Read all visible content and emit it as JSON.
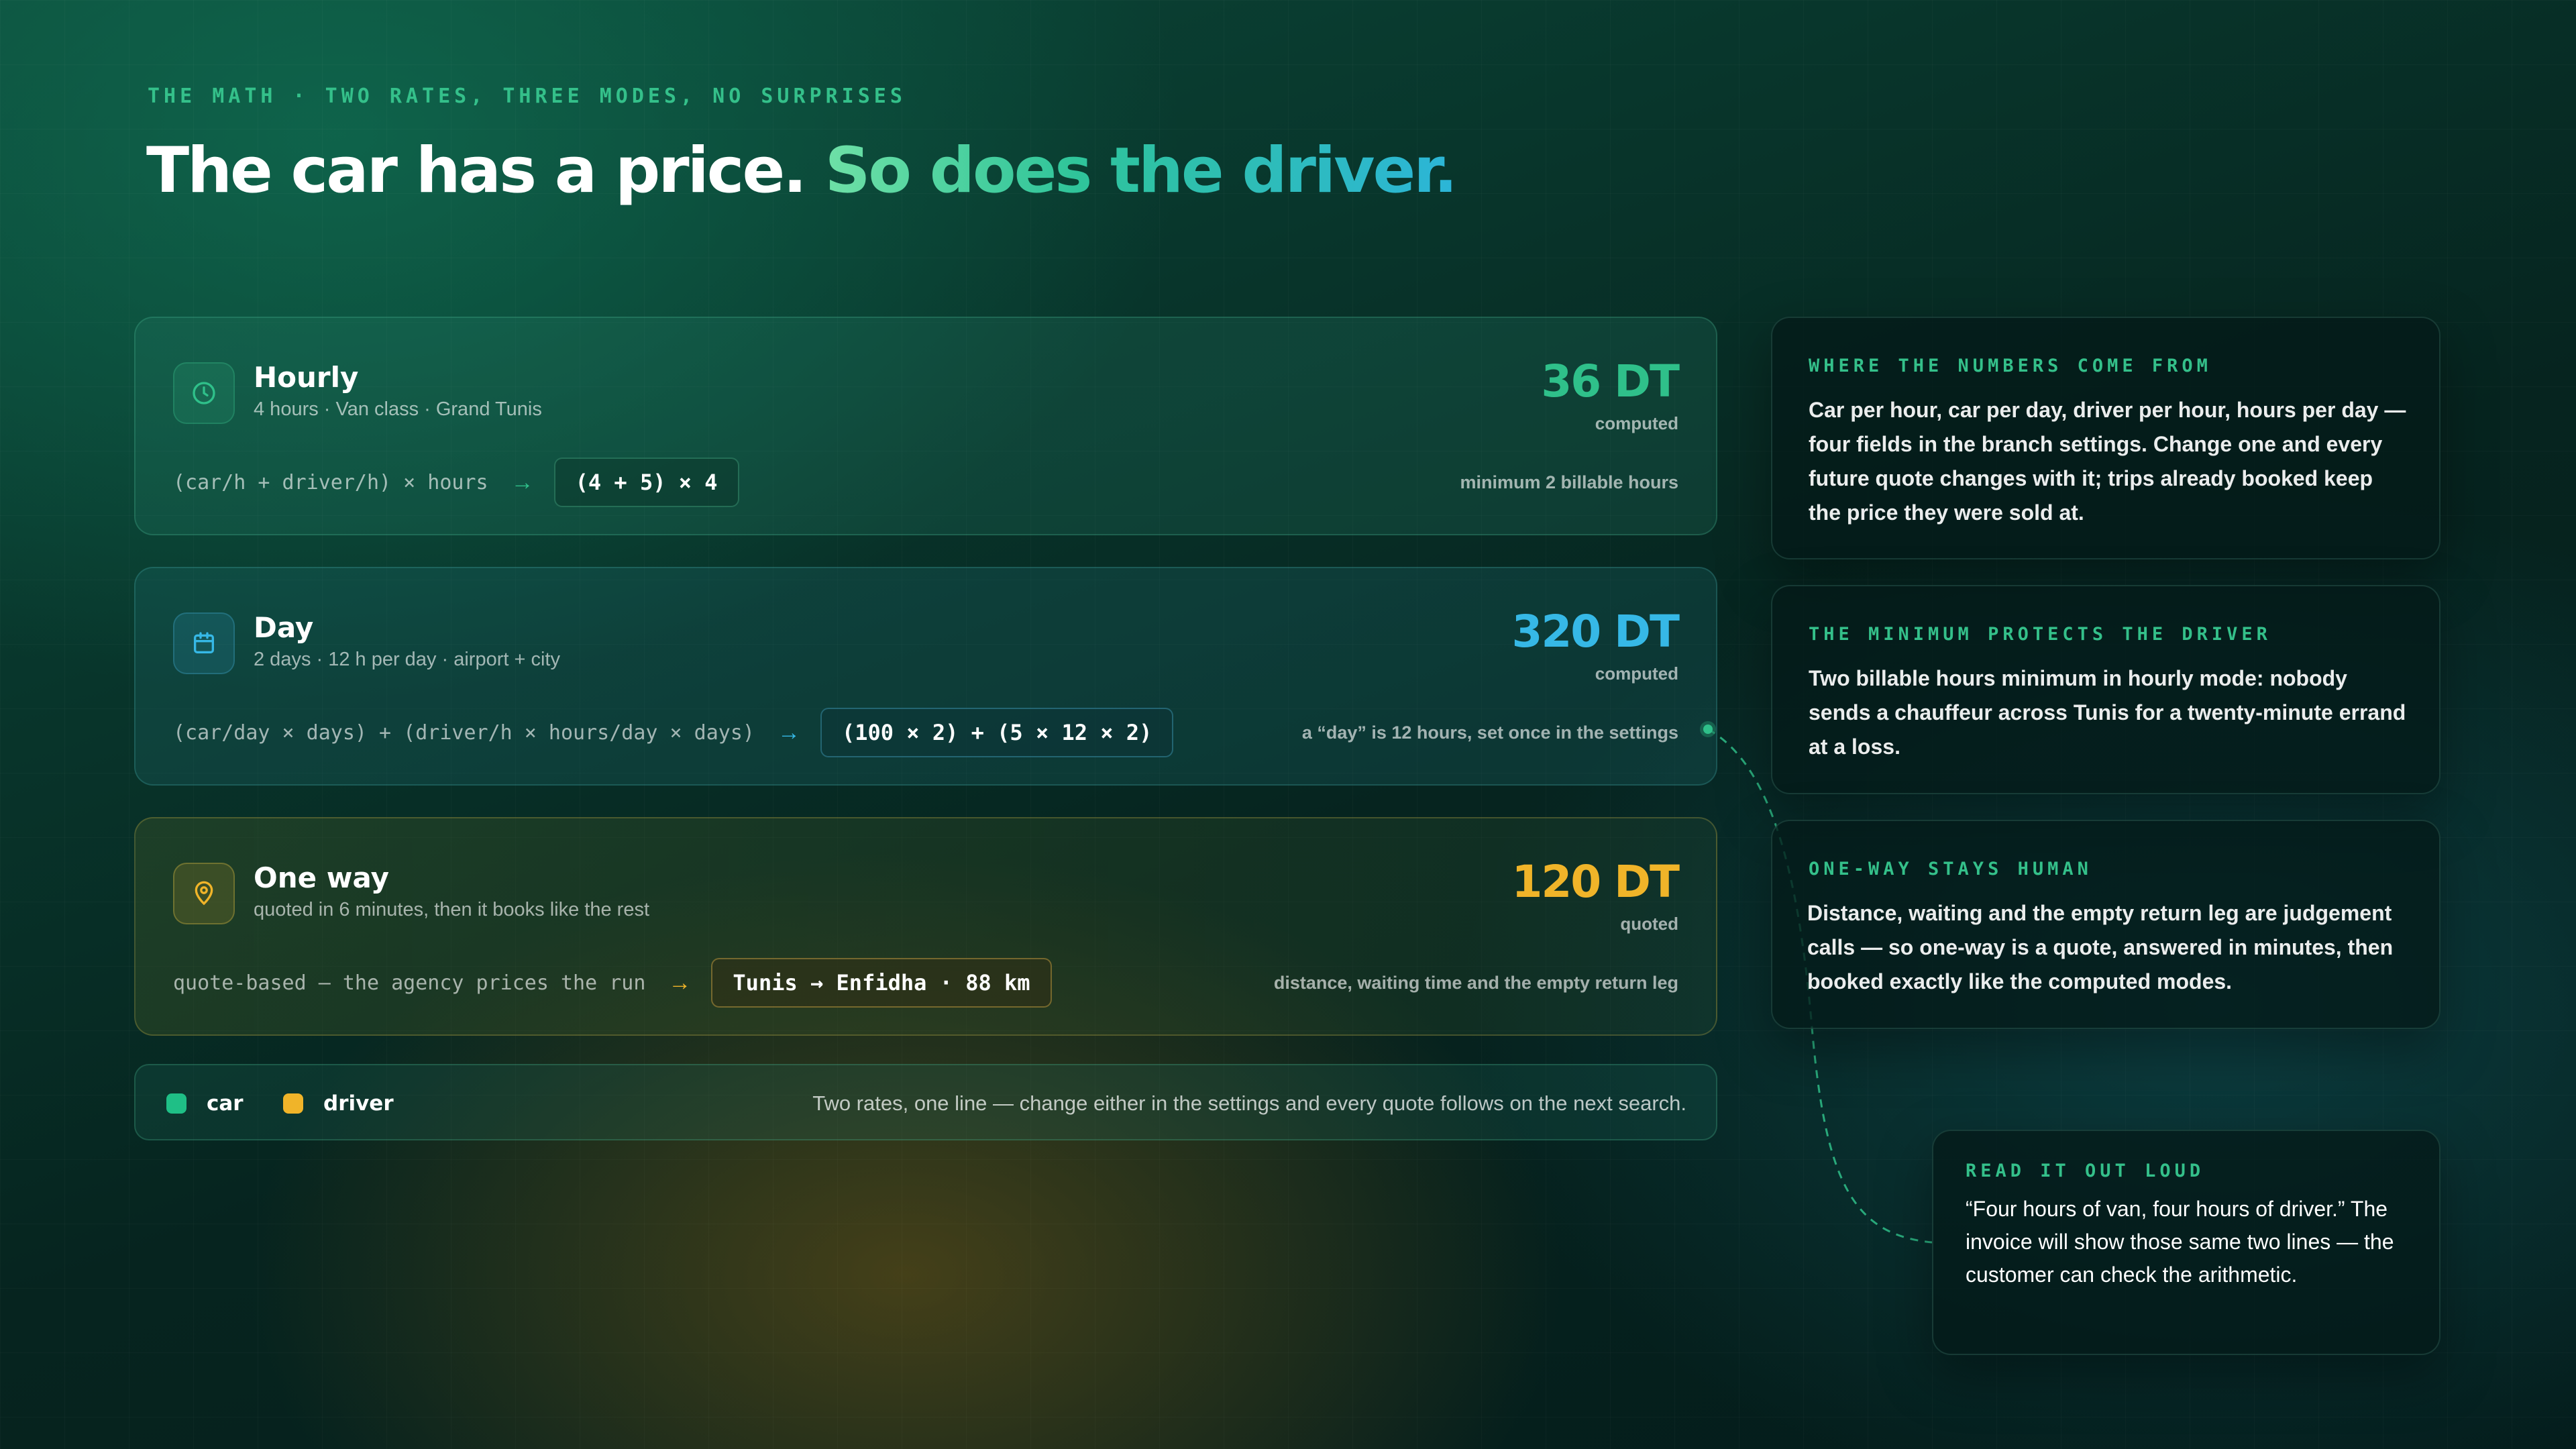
{
  "header": {
    "eyebrow": "THE MATH · TWO RATES, THREE MODES, NO SURPRISES",
    "headline_part1": "The car has a price. ",
    "headline_part2": "So does the driver."
  },
  "modes": [
    {
      "icon": "clock-icon",
      "title": "Hourly",
      "subtitle": "4 hours · Van class · Grand Tunis",
      "price": "36 DT",
      "price_note": "computed",
      "formula": "(car/h + driver/h) × hours",
      "arrow": "→",
      "chip": "(4 + 5) × 4",
      "note": "minimum 2 billable hours",
      "color": "#2fc08a"
    },
    {
      "icon": "calendar-icon",
      "title": "Day",
      "subtitle": "2 days · 12 h per day · airport + city",
      "price": "320 DT",
      "price_note": "computed",
      "formula": "(car/day × days) + (driver/h × hours/day × days)",
      "arrow": "→",
      "chip": "(100 × 2) + (5 × 12 × 2)",
      "note": "a “day” is 12 hours, set once in the settings",
      "color": "#36b8e6"
    },
    {
      "icon": "map-pin-icon",
      "title": "One way",
      "subtitle": "quoted in 6 minutes, then it books like the rest",
      "price": "120 DT",
      "price_note": "quoted",
      "formula": "quote-based — the agency prices the run",
      "arrow": "→",
      "chip": "Tunis → Enfidha · 88 km",
      "note": "distance, waiting time and the empty return leg",
      "color": "#f0b429"
    }
  ],
  "legend": {
    "items": [
      {
        "label": "car",
        "color": "#1fbf86"
      },
      {
        "label": "driver",
        "color": "#f0b429"
      }
    ],
    "note": "Two rates, one line — change either in the settings and every quote follows on the next search."
  },
  "notes": [
    {
      "label": "WHERE THE NUMBERS COME FROM",
      "body": "Car per hour, car per day, driver per hour, hours per day — four fields in the branch settings. Change one and every future quote changes with it; trips already booked keep the price they were sold at."
    },
    {
      "label": "THE MINIMUM PROTECTS THE DRIVER",
      "body": "Two billable hours minimum in hourly mode: nobody sends a chauffeur across Tunis for a twenty-minute errand at a loss."
    },
    {
      "label": "ONE-WAY STAYS HUMAN",
      "body": "Distance, waiting and the empty return leg are judgement calls — so one-way is a quote, answered in minutes, then booked exactly like the computed modes."
    },
    {
      "label": "READ IT OUT LOUD",
      "body": "“Four hours of van, four hours of driver.” The invoice will show those same two lines — the customer can check the arithmetic."
    }
  ]
}
